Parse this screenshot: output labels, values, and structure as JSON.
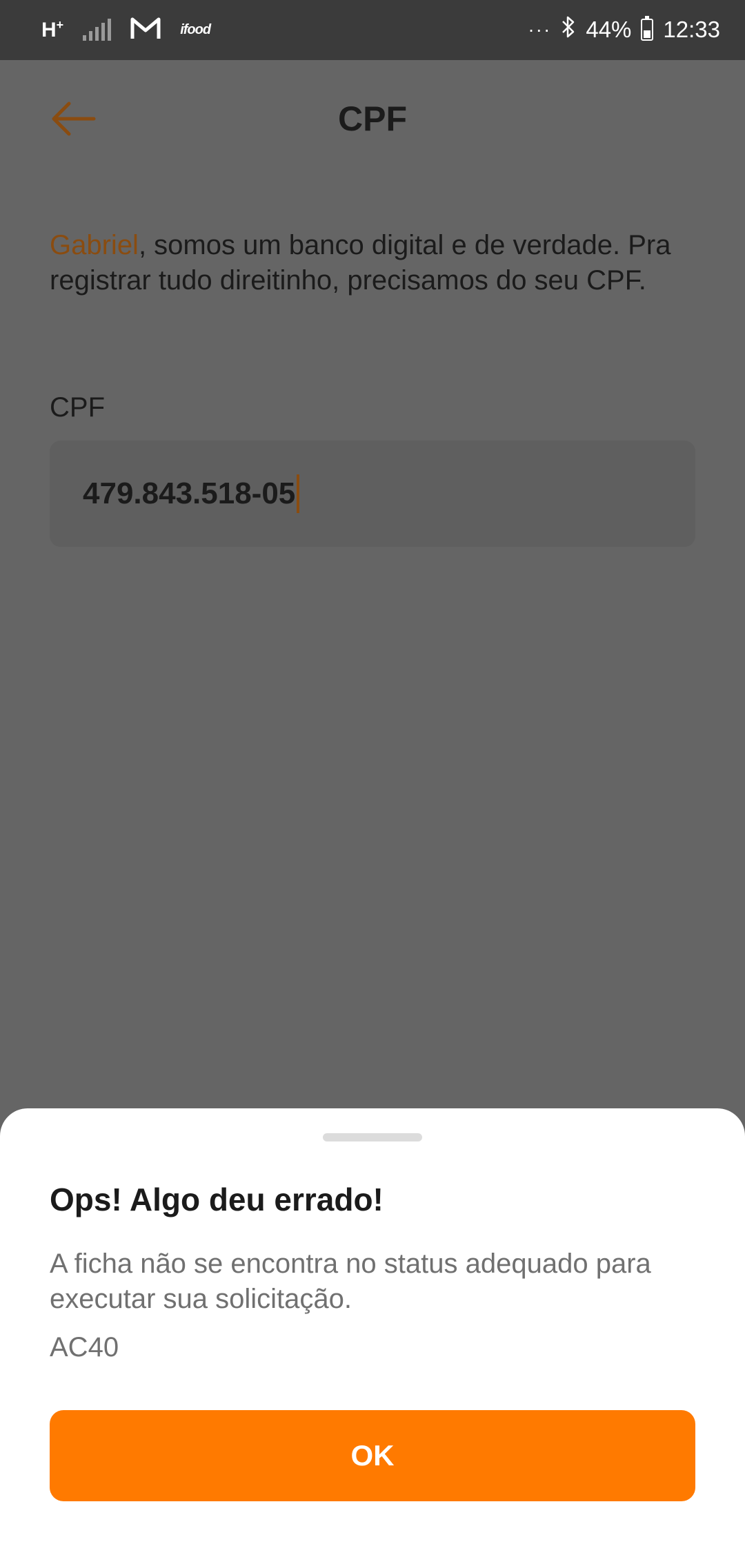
{
  "status_bar": {
    "network": "H",
    "network_sup": "+",
    "ifood_label": "ifood",
    "dots": "···",
    "battery": "44%",
    "time": "12:33",
    "battery_level": 0.44
  },
  "header": {
    "title": "CPF"
  },
  "intro": {
    "name": "Gabriel",
    "text": ", somos um banco digital e de verdade. Pra registrar tudo direitinho, precisamos do seu CPF."
  },
  "form": {
    "cpf_label": "CPF",
    "cpf_value": "479.843.518-05"
  },
  "sheet": {
    "title": "Ops! Algo deu errado!",
    "message": "A ficha não se encontra no status adequado para executar sua solicitação.",
    "code": "AC40",
    "ok_label": "OK"
  },
  "colors": {
    "accent": "#ff7a00",
    "accent_dim": "#8a4c10",
    "overlay": "#656565"
  }
}
